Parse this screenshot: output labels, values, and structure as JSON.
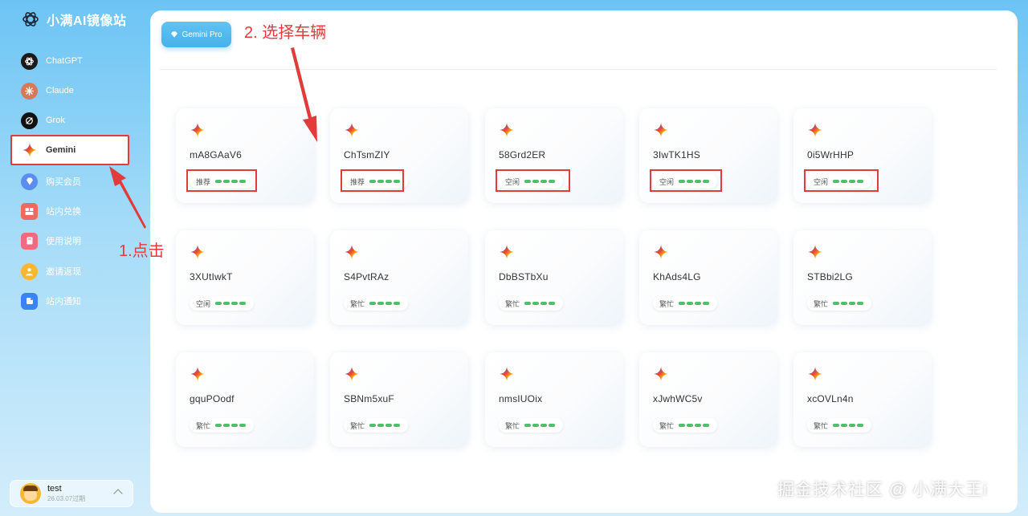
{
  "app": {
    "title": "小满AI镜像站"
  },
  "sidebar": {
    "items": [
      {
        "label": "ChatGPT",
        "icon": "chatgpt-icon",
        "color": "#1a1a1a"
      },
      {
        "label": "Claude",
        "icon": "claude-icon",
        "color": "#d97757"
      },
      {
        "label": "Grok",
        "icon": "grok-icon",
        "color": "#111111"
      },
      {
        "label": "Gemini",
        "icon": "gemini-icon",
        "color": "#ffffff"
      },
      {
        "label": "购买会员",
        "icon": "diamond-icon",
        "color": "#5b8def"
      },
      {
        "label": "站内兑换",
        "icon": "exchange-icon",
        "color": "#f0695f"
      },
      {
        "label": "使用说明",
        "icon": "book-icon",
        "color": "#f06a80"
      },
      {
        "label": "邀请返现",
        "icon": "invite-icon",
        "color": "#f7b731"
      },
      {
        "label": "站内通知",
        "icon": "notice-icon",
        "color": "#3a82f7"
      }
    ],
    "active_index": 3
  },
  "user": {
    "name": "test",
    "expire": "26.03.07过期"
  },
  "main": {
    "tab_label": "Gemini Pro"
  },
  "cards": [
    {
      "name": "mA8GAaV6",
      "status": "推荐"
    },
    {
      "name": "ChTsmZIY",
      "status": "推荐"
    },
    {
      "name": "58Grd2ER",
      "status": "空闲"
    },
    {
      "name": "3IwTK1HS",
      "status": "空闲"
    },
    {
      "name": "0i5WrHHP",
      "status": "空闲"
    },
    {
      "name": "3XUtIwkT",
      "status": "空闲"
    },
    {
      "name": "S4PvtRAz",
      "status": "繁忙"
    },
    {
      "name": "DbBSTbXu",
      "status": "繁忙"
    },
    {
      "name": "KhAds4LG",
      "status": "繁忙"
    },
    {
      "name": "STBbi2LG",
      "status": "繁忙"
    },
    {
      "name": "gquPOodf",
      "status": "繁忙"
    },
    {
      "name": "SBNm5xuF",
      "status": "繁忙"
    },
    {
      "name": "nmsIUOix",
      "status": "繁忙"
    },
    {
      "name": "xJwhWC5v",
      "status": "繁忙"
    },
    {
      "name": "xcOVLn4n",
      "status": "繁忙"
    }
  ],
  "annotations": {
    "step1": "1.点击",
    "step2": "2. 选择车辆"
  },
  "watermark": "掘金技术社区 @ 小满大王i",
  "colors": {
    "accent": "#46b1ea",
    "annotation": "#e23b3b",
    "status_bar": "#4cbf6b"
  }
}
